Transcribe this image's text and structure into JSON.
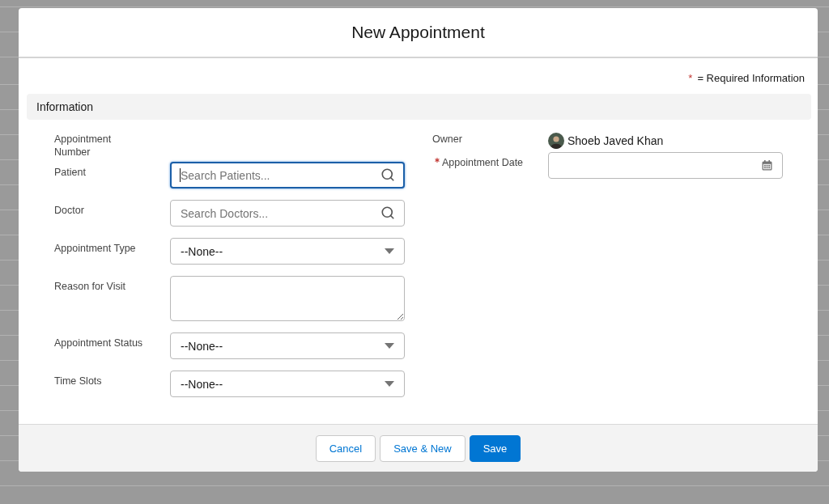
{
  "modal": {
    "title": "New Appointment"
  },
  "required_note": {
    "mark": "*",
    "text": "= Required Information"
  },
  "section": {
    "title": "Information"
  },
  "left_fields": [
    {
      "kind": "readonly",
      "label": "Appointment Number",
      "required": false
    },
    {
      "kind": "lookup",
      "label": "Patient",
      "placeholder": "Search Patients...",
      "focused": true,
      "required": false
    },
    {
      "kind": "lookup",
      "label": "Doctor",
      "placeholder": "Search Doctors...",
      "focused": false,
      "required": false
    },
    {
      "kind": "picklist",
      "label": "Appointment Type",
      "value": "--None--",
      "required": false
    },
    {
      "kind": "textarea",
      "label": "Reason for Visit",
      "required": false
    },
    {
      "kind": "picklist",
      "label": "Appointment Status",
      "value": "--None--",
      "required": false
    },
    {
      "kind": "picklist",
      "label": "Time Slots",
      "value": "--None--",
      "required": false
    }
  ],
  "right_fields": [
    {
      "kind": "user",
      "label": "Owner",
      "value": "Shoeb Javed Khan",
      "required": false
    },
    {
      "kind": "date",
      "label": "Appointment Date",
      "required": true
    }
  ],
  "buttons": [
    {
      "label": "Cancel",
      "kind": "neutral"
    },
    {
      "label": "Save & New",
      "kind": "neutral"
    },
    {
      "label": "Save",
      "kind": "brand"
    }
  ]
}
